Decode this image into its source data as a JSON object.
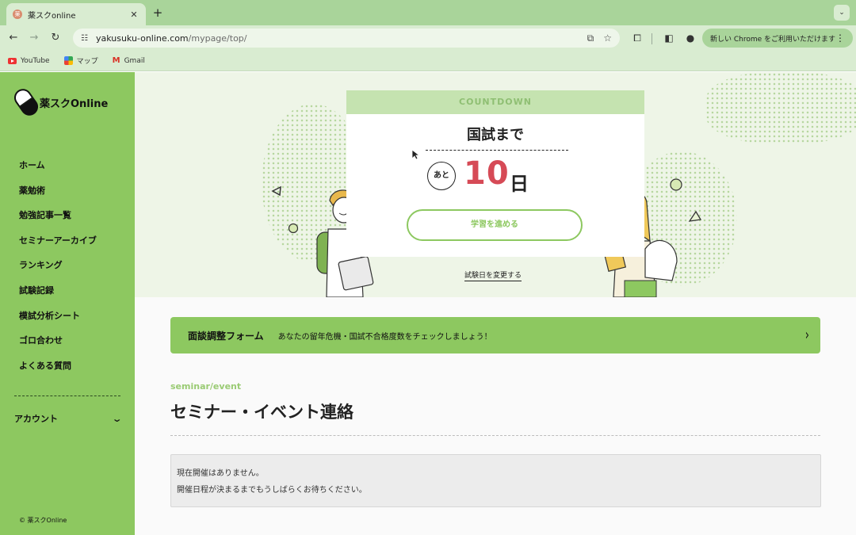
{
  "browser": {
    "tab_title": "薬スクonline",
    "tab_close": "✕",
    "new_tab": "+",
    "tab_menu": "⌄",
    "url_host": "yakusuku-online.com",
    "url_path": "/mypage/top/",
    "update_label": "新しい Chrome をご利用いただけます",
    "bookmarks": [
      "YouTube",
      "マップ",
      "Gmail"
    ]
  },
  "sidebar": {
    "logo": "薬スクOnline",
    "items": [
      "ホーム",
      "薬勉術",
      "勉強記事一覧",
      "セミナーアーカイブ",
      "ランキング",
      "試験記録",
      "模試分析シート",
      "ゴロ合わせ",
      "よくある質問"
    ],
    "account": "アカウント",
    "copyright": "© 薬スクOnline"
  },
  "countdown": {
    "header": "COUNTDOWN",
    "label": "国試まで",
    "prefix": "あと",
    "days": "10",
    "unit": "日",
    "study_button": "学習を進める",
    "change_date": "試験日を変更する"
  },
  "banner": {
    "title": "面談調整フォーム",
    "description": "あなたの留年危機・国試不合格度数をチェックしましょう！"
  },
  "seminar": {
    "en_label": "seminar/event",
    "title": "セミナー・イベント連絡",
    "notice_line1": "現在開催はありません。",
    "notice_line2": "開催日程が決まるまでもうしばらくお待ちください。"
  },
  "colors": {
    "accent_green": "#8dc860",
    "countdown_red": "#d64a56",
    "header_green": "#c5e3b0"
  },
  "icons": [
    "back-icon",
    "forward-icon",
    "reload-icon",
    "tune-icon",
    "install-icon",
    "star-icon",
    "extensions-icon",
    "sidepanel-icon",
    "profile-icon",
    "kebab-icon",
    "chevron-down-icon",
    "chevron-right-icon"
  ]
}
